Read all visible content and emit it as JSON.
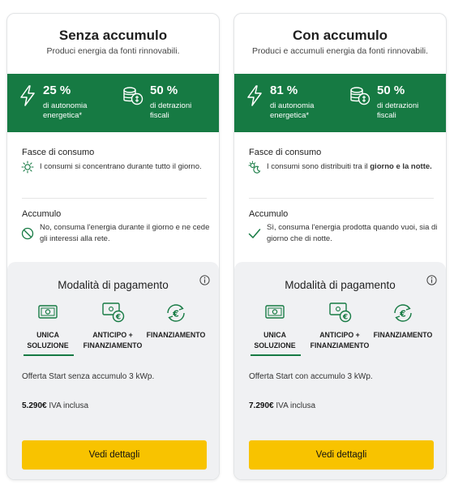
{
  "colors": {
    "green_band": "#167a43",
    "button_yellow": "#f8c300",
    "pay_bg": "#f0f1f3"
  },
  "cards": [
    {
      "title": "Senza accumulo",
      "subtitle": "Produci energia da fonti rinnovabili.",
      "stat1": {
        "value": "25 %",
        "label": "di autonomia\nenergetica*",
        "icon": "lightning-bolt-icon"
      },
      "stat2": {
        "value": "50 %",
        "label": "di detrazioni\nfiscali",
        "icon": "coins-stack-icon"
      },
      "consumption": {
        "heading": "Fasce di consumo",
        "icon": "sun-icon",
        "text": "I consumi si concentrano durante tutto il giorno."
      },
      "storage": {
        "heading": "Accumulo",
        "icon": "prohibited-icon",
        "text": "No, consuma l'energia durante il giorno e ne cede gli interessi alla rete."
      },
      "payment": {
        "title": "Modalità di pagamento",
        "options": [
          {
            "label": "UNICA\nSOLUZIONE",
            "icon": "banknote-icon",
            "selected": true
          },
          {
            "label": "ANTICIPO +\nFINANZIAMENTO",
            "icon": "banknote-euro-icon",
            "selected": false
          },
          {
            "label": "FINANZIAMENTO",
            "icon": "euro-cycle-icon",
            "selected": false
          }
        ],
        "offer": "Offerta Start senza accumulo 3 kWp.",
        "price": "5.290€",
        "price_suffix": " IVA inclusa",
        "button": "Vedi dettagli"
      }
    },
    {
      "title": "Con accumulo",
      "subtitle": "Produci e accumuli energia da fonti rinnovabili.",
      "stat1": {
        "value": "81 %",
        "label": "di autonomia\nenergetica*",
        "icon": "lightning-bolt-icon"
      },
      "stat2": {
        "value": "50 %",
        "label": "di detrazioni\nfiscali",
        "icon": "coins-stack-icon"
      },
      "consumption": {
        "heading": "Fasce di consumo",
        "icon": "sun-moon-icon",
        "text_pre": "I consumi sono distribuiti tra il ",
        "text_bold": "giorno e la notte."
      },
      "storage": {
        "heading": "Accumulo",
        "icon": "check-icon",
        "text": "Sì, consuma l'energia prodotta quando vuoi, sia di giorno che di notte."
      },
      "payment": {
        "title": "Modalità di pagamento",
        "options": [
          {
            "label": "UNICA\nSOLUZIONE",
            "icon": "banknote-icon",
            "selected": true
          },
          {
            "label": "ANTICIPO +\nFINANZIAMENTO",
            "icon": "banknote-euro-icon",
            "selected": false
          },
          {
            "label": "FINANZIAMENTO",
            "icon": "euro-cycle-icon",
            "selected": false
          }
        ],
        "offer": "Offerta Start con accumulo 3 kWp.",
        "price": "7.290€",
        "price_suffix": " IVA inclusa",
        "button": "Vedi dettagli"
      }
    }
  ]
}
